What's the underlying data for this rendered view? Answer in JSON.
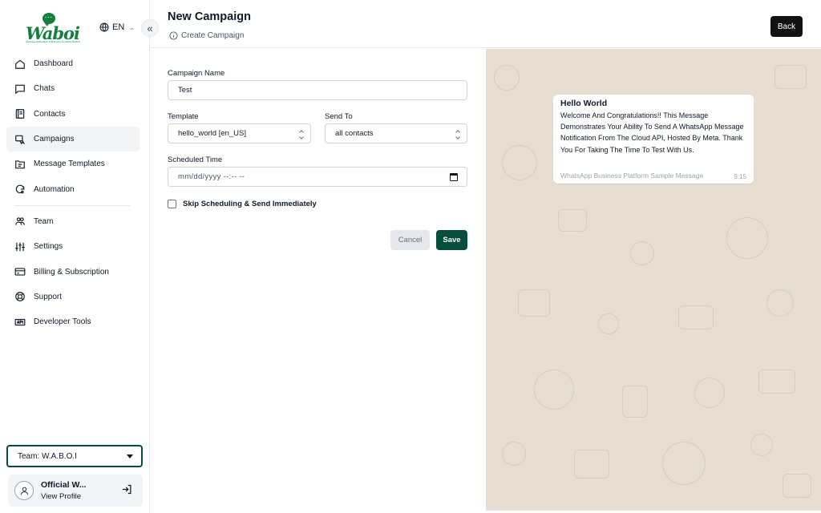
{
  "brand": {
    "name": "Waboi",
    "tagline": "Message Automation & Business Contacts Method"
  },
  "language": {
    "code": "EN"
  },
  "sidebar": {
    "items": [
      {
        "label": "Dashboard",
        "icon": "home-icon",
        "active": false
      },
      {
        "label": "Chats",
        "icon": "chat-icon",
        "active": false
      },
      {
        "label": "Contacts",
        "icon": "contacts-icon",
        "active": false
      },
      {
        "label": "Campaigns",
        "icon": "campaign-icon",
        "active": true
      },
      {
        "label": "Message Templates",
        "icon": "template-icon",
        "active": false
      },
      {
        "label": "Automation",
        "icon": "automation-icon",
        "active": false
      },
      {
        "label": "Team",
        "icon": "team-icon",
        "active": false
      },
      {
        "label": "Settings",
        "icon": "sliders-icon",
        "active": false
      },
      {
        "label": "Billing & Subscription",
        "icon": "card-icon",
        "active": false
      },
      {
        "label": "Support",
        "icon": "lifebuoy-icon",
        "active": false
      },
      {
        "label": "Developer Tools",
        "icon": "api-icon",
        "active": false
      }
    ],
    "team_select": "Team: W.A.B.O.I",
    "profile": {
      "name": "Official W...",
      "link": "View Profile"
    }
  },
  "header": {
    "title": "New Campaign",
    "subtitle": "Create Campaign",
    "back_label": "Back"
  },
  "form": {
    "campaign_name_label": "Campaign Name",
    "campaign_name_value": "Test",
    "template_label": "Template",
    "template_value": "hello_world [en_US]",
    "send_to_label": "Send To",
    "send_to_value": "all contacts",
    "scheduled_label": "Scheduled Time",
    "scheduled_placeholder": "mm/dd/yyyy --:-- --",
    "skip_label": "Skip Scheduling & Send Immediately",
    "cancel_label": "Cancel",
    "save_label": "Save"
  },
  "preview": {
    "title": "Hello World",
    "body": "Welcome And Congratulations!! This Message Demonstrates Your Ability To Send A WhatsApp Message Notification From The Cloud API, Hosted By Meta. Thank You For Taking The Time To Test With Us.",
    "footer": "WhatsApp Business Platform Sample Message",
    "time": "9:15"
  },
  "colors": {
    "accent": "#064e3b",
    "brand_green": "#15803d",
    "preview_bg": "#e6ded3"
  }
}
